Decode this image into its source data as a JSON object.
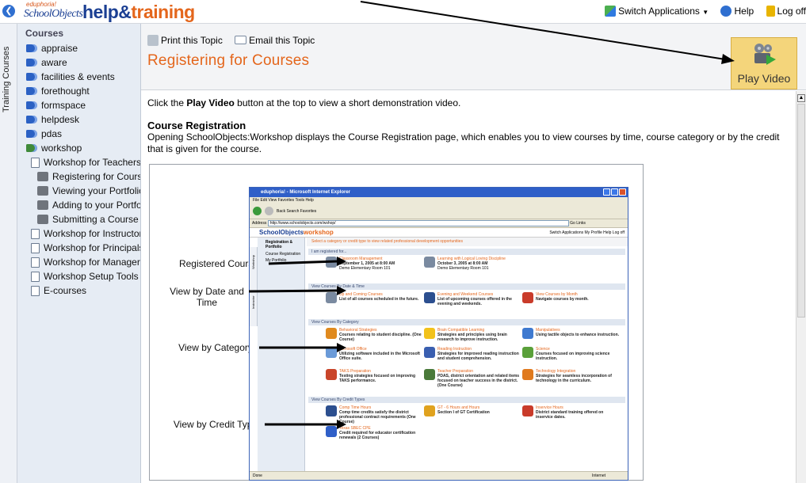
{
  "header": {
    "logo_superscript": "eduphoria!",
    "logo_school": "SchoolObjects",
    "logo_help": "help&",
    "logo_training": "training",
    "switch_label": "Switch Applications",
    "help_label": "Help",
    "logoff_label": "Log off"
  },
  "sidebar": {
    "tab_label": "Training Courses",
    "heading": "Courses",
    "items": [
      {
        "label": "appraise",
        "icon": "book-icon",
        "level": 1
      },
      {
        "label": "aware",
        "icon": "book-icon",
        "level": 1
      },
      {
        "label": "facilities & events",
        "icon": "book-icon",
        "level": 1
      },
      {
        "label": "forethought",
        "icon": "book-icon",
        "level": 1
      },
      {
        "label": "formspace",
        "icon": "book-icon",
        "level": 1
      },
      {
        "label": "helpdesk",
        "icon": "book-icon",
        "level": 1
      },
      {
        "label": "pdas",
        "icon": "book-icon",
        "level": 1
      },
      {
        "label": "workshop",
        "icon": "open-book-icon",
        "level": 1
      },
      {
        "label": "Workshop for Teachers",
        "icon": "page-icon",
        "level": 2
      },
      {
        "label": "Registering for Courses",
        "icon": "movie-icon",
        "level": 3
      },
      {
        "label": "Viewing your Portfolio",
        "icon": "movie-icon",
        "level": 3
      },
      {
        "label": "Adding to your Portfolio",
        "icon": "movie-icon",
        "level": 3
      },
      {
        "label": "Submitting a Course",
        "icon": "movie-icon",
        "level": 3
      },
      {
        "label": "Workshop for Instructors",
        "icon": "page-icon",
        "level": 2
      },
      {
        "label": "Workshop for Principals",
        "icon": "page-icon",
        "level": 2
      },
      {
        "label": "Workshop for Managers",
        "icon": "page-icon",
        "level": 2
      },
      {
        "label": "Workshop Setup Tools",
        "icon": "page-icon",
        "level": 2
      },
      {
        "label": "E-courses",
        "icon": "page-icon",
        "level": 2
      }
    ]
  },
  "content": {
    "print_label": "Print this Topic",
    "email_label": "Email this Topic",
    "title": "Registering for Courses",
    "play_video_label": "Play Video",
    "intro_prefix": "Click the ",
    "intro_bold": "Play Video",
    "intro_suffix": " button at the top to view a short demonstration video.",
    "section_heading": "Course Registration",
    "section_text": "Opening SchoolObjects:Workshop displays the Course Registration page, which enables you to view courses by time, course category or by the credit that is given for the course."
  },
  "figure": {
    "callouts": [
      "Registered Courses",
      "View by Date and Time",
      "View by Category",
      "View by Credit Type"
    ],
    "mini": {
      "window_title": "eduphoria! - Microsoft Internet Explorer",
      "menu": "File   Edit   View   Favorites   Tools   Help",
      "toolbar": "Back   Search   Favorites",
      "address_label": "Address",
      "address": "http://www.schoolobjects.com/wshop/",
      "go_label": "Go",
      "links_label": "Links",
      "app_logo_a": "SchoolObjects",
      "app_logo_b": "workshop",
      "app_links": "Switch Applications   My Profile   Help   Log off",
      "left_heading": "Registration & Portfolio",
      "left_items": [
        "Course Registration",
        "My Portfolio"
      ],
      "side_tabs": [
        "Workshop",
        "Instructor"
      ],
      "hint": "Select a category or credit type to view related professional development opportunities",
      "sections": [
        "I am registered for...",
        "View Courses By Date & Time",
        "View Courses By Category",
        "View Courses By Credit Types"
      ],
      "items": [
        {
          "t": "Classroom Management",
          "d": "September 1, 2005 at 8:00 AM",
          "s": "Demo Elementary Room 101",
          "c": "#7a8aa0"
        },
        {
          "t": "Learning with Logical Loving Discipline",
          "d": "October 3, 2005 at 8:00 AM",
          "s": "Demo Elementary Room 101",
          "c": "#7a8aa0"
        },
        {
          "t": "Up and Coming Courses",
          "d": "List of all courses scheduled in the future.",
          "s": "",
          "c": "#7a8aa0"
        },
        {
          "t": "Evening and Weekend Courses",
          "d": "List of upcoming courses offered in the evening and weekends.",
          "s": "",
          "c": "#2c4f8f"
        },
        {
          "t": "View Courses by Month",
          "d": "Navigate courses by month.",
          "s": "",
          "c": "#c93b2a"
        },
        {
          "t": "Behavioral Strategies",
          "d": "Courses relating to student discipline. (One Course)",
          "s": "",
          "c": "#e08a1e"
        },
        {
          "t": "Brain Compatible Learning",
          "d": "Strategies and principles using brain research to improve instruction.",
          "s": "",
          "c": "#f2c21b"
        },
        {
          "t": "Manipulatives",
          "d": "Using tactile objects to enhance instruction.",
          "s": "",
          "c": "#3f7ad0"
        },
        {
          "t": "Microsoft Office",
          "d": "Utilizing software included in the Microsoft Office suite.",
          "s": "",
          "c": "#6a9ad8"
        },
        {
          "t": "Reading Instruction",
          "d": "Strategies for improved reading instruction and student comprehension.",
          "s": "",
          "c": "#3a5fb0"
        },
        {
          "t": "Science",
          "d": "Courses focused on improving science instruction.",
          "s": "",
          "c": "#5aa03a"
        },
        {
          "t": "TAKS Preparation",
          "d": "Testing strategies focused on improving TAKS performance.",
          "s": "",
          "c": "#c9452a"
        },
        {
          "t": "Teacher Preparation",
          "d": "PDAS, district orientation and related items focused on teacher success in the district. (One Course)",
          "s": "",
          "c": "#4a7a3a"
        },
        {
          "t": "Technology Integration",
          "d": "Strategies for seamless incorporation of technology in the curriculum.",
          "s": "",
          "c": "#e07a1e"
        },
        {
          "t": "Comp Time Hours",
          "d": "Comp time credits satisfy the district professional contract requirements (One Course)",
          "s": "",
          "c": "#2c4f8f"
        },
        {
          "t": "GT - 6 Hours and Hours",
          "d": "Section I of GT Certification",
          "s": "",
          "c": "#e0a21e"
        },
        {
          "t": "Inservice Hours",
          "d": "District standard training offered on inservice dates.",
          "s": "",
          "c": "#c93b2a"
        },
        {
          "t": "Texas SBEC CPE",
          "d": "Credit required for educator certification renewals (2 Courses)",
          "s": "",
          "c": "#2f5fc8"
        }
      ],
      "status_left": "Done",
      "status_right": "Internet"
    }
  },
  "colors": {
    "accent_orange": "#e4661c",
    "brand_blue": "#1b3f93",
    "play_video_bg": "#f4d57b"
  }
}
